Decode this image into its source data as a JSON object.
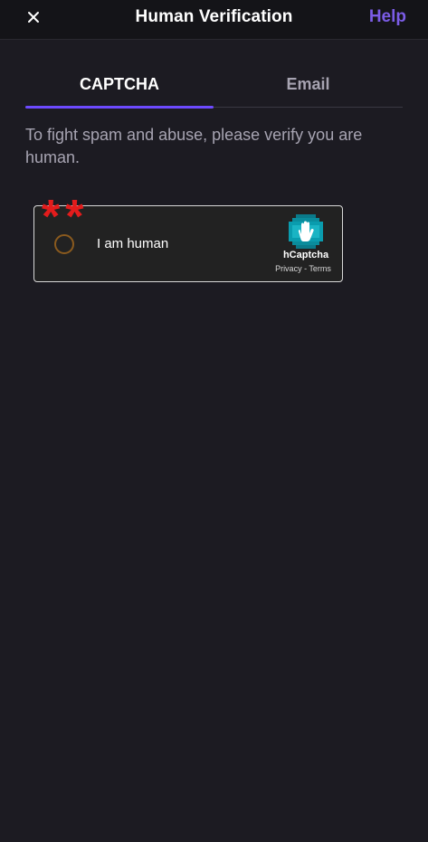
{
  "header": {
    "title": "Human Verification",
    "help_label": "Help",
    "close_icon": "close-icon"
  },
  "tabs": [
    {
      "label": "CAPTCHA",
      "active": true
    },
    {
      "label": "Email",
      "active": false
    }
  ],
  "description": "To fight spam and abuse, please verify you are human.",
  "captcha": {
    "asterisks": "**",
    "label": "I am human",
    "brand": "hCaptcha",
    "privacy_label": "Privacy",
    "separator": " - ",
    "terms_label": "Terms",
    "logo_icon": "hcaptcha-hand-icon"
  },
  "colors": {
    "background": "#1c1b22",
    "header_bg": "#141418",
    "accent": "#6d4aff",
    "help": "#7b5ce6",
    "muted_text": "#a7a4b2",
    "asterisk": "#e31c1c"
  }
}
